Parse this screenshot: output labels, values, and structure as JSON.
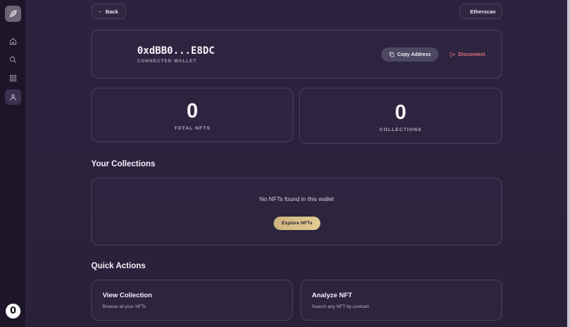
{
  "sidebar": {
    "logo_icon": "feather-icon",
    "items": [
      {
        "icon": "home-icon",
        "active": false
      },
      {
        "icon": "search-icon",
        "active": false
      },
      {
        "icon": "grid-icon",
        "active": false
      },
      {
        "icon": "user-icon",
        "active": true
      }
    ],
    "bottom_badge": "0"
  },
  "header": {
    "back_label": "Back",
    "etherscan_label": "Etherscan"
  },
  "wallet": {
    "address": "0xdBB0...E8DC",
    "subtitle": "CONNECTED WALLET",
    "copy_label": "Copy Address",
    "disconnect_label": "Disconnect"
  },
  "stats": [
    {
      "value": "0",
      "label": "TOTAL NFTS"
    },
    {
      "value": "0",
      "label": "COLLECTIONS"
    }
  ],
  "collections": {
    "title": "Your Collections",
    "empty_text": "No NFTs found in this wallet",
    "explore_label": "Explore NFTs"
  },
  "quick_actions": {
    "title": "Quick Actions",
    "items": [
      {
        "title": "View Collection",
        "subtitle": "Browse all your NFTs"
      },
      {
        "title": "Analyze NFT",
        "subtitle": "Search any NFT by contract"
      }
    ]
  },
  "colors": {
    "accent_gold": "#d9c289",
    "danger": "#e8737e",
    "background": "#2c2340"
  }
}
